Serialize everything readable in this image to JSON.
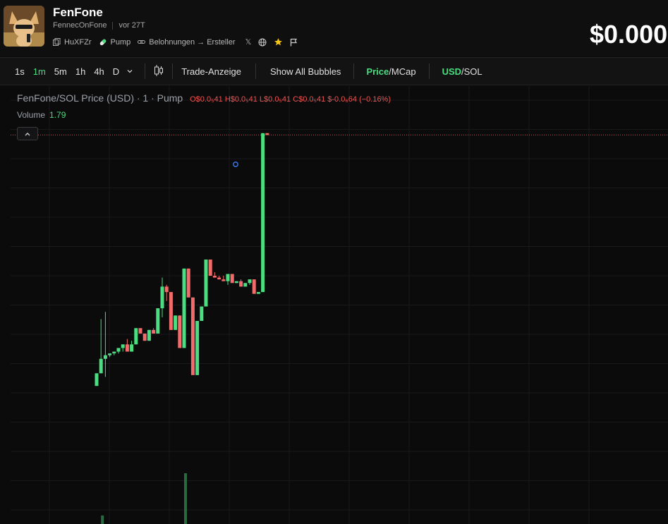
{
  "header": {
    "title": "FenFone",
    "subtitle": "FennecOnFone",
    "age": "vor 27T",
    "meta": {
      "address": "HuXFZr",
      "platform": "Pump",
      "rewards": "Belohnungen → Ersteller",
      "x_icon": "x-social-icon",
      "globe_icon": "globe-icon",
      "star_icon": "star-icon",
      "flag_icon": "flag-icon"
    },
    "price": "$0.000"
  },
  "toolbar": {
    "timeframes": [
      "1s",
      "1m",
      "5m",
      "1h",
      "4h",
      "D"
    ],
    "active_timeframe": "1m",
    "candle_icon": "candlestick-icon",
    "trade_display": "Trade-Anzeige",
    "show_all_bubbles": "Show All Bubbles",
    "price_label": "Price",
    "mcap_label": "MCap",
    "usd_label": "USD",
    "sol_label": "SOL"
  },
  "legend": {
    "title": "FenFone/SOL Price (USD) · 1 · Pump",
    "o": "O$0.0₅41",
    "h": "H$0.0₅41",
    "l": "L$0.0₅41",
    "c": "C$0.0₅41",
    "change": "$-0.0₆64 (−0.16%)",
    "volume_label": "Volume",
    "volume_value": "1.79"
  },
  "colors": {
    "up": "#4ade80",
    "down": "#f26b6b",
    "accent": "#4ade80",
    "background": "#0b0b0c",
    "grid": "#1a1a1c"
  },
  "chart_data": {
    "type": "candlestick",
    "candles": [
      {
        "o": 1.55,
        "h": 1.62,
        "l": 1.55,
        "c": 1.62
      },
      {
        "o": 1.62,
        "h": 1.92,
        "l": 1.62,
        "c": 1.7
      },
      {
        "o": 1.7,
        "h": 1.96,
        "l": 1.6,
        "c": 1.72
      },
      {
        "o": 1.72,
        "h": 1.73,
        "l": 1.71,
        "c": 1.73
      },
      {
        "o": 1.73,
        "h": 1.74,
        "l": 1.72,
        "c": 1.74
      },
      {
        "o": 1.74,
        "h": 1.76,
        "l": 1.73,
        "c": 1.76
      },
      {
        "o": 1.76,
        "h": 1.78,
        "l": 1.74,
        "c": 1.78
      },
      {
        "o": 1.78,
        "h": 1.81,
        "l": 1.75,
        "c": 1.74
      },
      {
        "o": 1.74,
        "h": 1.8,
        "l": 1.74,
        "c": 1.78
      },
      {
        "o": 1.78,
        "h": 1.87,
        "l": 1.78,
        "c": 1.87
      },
      {
        "o": 1.87,
        "h": 1.87,
        "l": 1.84,
        "c": 1.84
      },
      {
        "o": 1.84,
        "h": 1.84,
        "l": 1.8,
        "c": 1.8
      },
      {
        "o": 1.8,
        "h": 1.86,
        "l": 1.8,
        "c": 1.86
      },
      {
        "o": 1.86,
        "h": 1.87,
        "l": 1.84,
        "c": 1.84
      },
      {
        "o": 1.84,
        "h": 1.98,
        "l": 1.84,
        "c": 1.98
      },
      {
        "o": 1.98,
        "h": 2.15,
        "l": 1.93,
        "c": 2.1
      },
      {
        "o": 2.1,
        "h": 2.11,
        "l": 2.02,
        "c": 2.07
      },
      {
        "o": 2.07,
        "h": 2.07,
        "l": 1.86,
        "c": 1.86
      },
      {
        "o": 1.86,
        "h": 1.94,
        "l": 1.86,
        "c": 1.94
      },
      {
        "o": 1.94,
        "h": 1.94,
        "l": 1.76,
        "c": 1.76
      },
      {
        "o": 1.76,
        "h": 2.2,
        "l": 1.76,
        "c": 2.2
      },
      {
        "o": 2.2,
        "h": 2.2,
        "l": 2.04,
        "c": 2.04
      },
      {
        "o": 2.04,
        "h": 2.04,
        "l": 1.61,
        "c": 1.61
      },
      {
        "o": 1.61,
        "h": 1.91,
        "l": 1.61,
        "c": 1.91
      },
      {
        "o": 1.91,
        "h": 1.99,
        "l": 1.91,
        "c": 1.99
      },
      {
        "o": 1.99,
        "h": 2.25,
        "l": 1.99,
        "c": 2.25
      },
      {
        "o": 2.25,
        "h": 2.25,
        "l": 2.16,
        "c": 2.16
      },
      {
        "o": 2.16,
        "h": 2.18,
        "l": 2.15,
        "c": 2.15
      },
      {
        "o": 2.15,
        "h": 2.16,
        "l": 2.14,
        "c": 2.14
      },
      {
        "o": 2.14,
        "h": 2.16,
        "l": 2.13,
        "c": 2.13
      },
      {
        "o": 2.13,
        "h": 2.17,
        "l": 2.11,
        "c": 2.17
      },
      {
        "o": 2.17,
        "h": 2.17,
        "l": 2.12,
        "c": 2.12
      },
      {
        "o": 2.12,
        "h": 2.13,
        "l": 2.12,
        "c": 2.13
      },
      {
        "o": 2.13,
        "h": 2.14,
        "l": 2.1,
        "c": 2.1
      },
      {
        "o": 2.1,
        "h": 2.12,
        "l": 2.1,
        "c": 2.12
      },
      {
        "o": 2.12,
        "h": 2.14,
        "l": 2.11,
        "c": 2.14
      },
      {
        "o": 2.14,
        "h": 2.14,
        "l": 2.06,
        "c": 2.06
      },
      {
        "o": 2.06,
        "h": 2.07,
        "l": 2.06,
        "c": 2.07
      },
      {
        "o": 2.07,
        "h": 2.95,
        "l": 2.07,
        "c": 2.95
      },
      {
        "o": 2.95,
        "h": 2.95,
        "l": 2.94,
        "c": 2.94
      }
    ],
    "volume": [
      {
        "index": 1,
        "value": 0.3
      },
      {
        "index": 20,
        "value": 1.79
      }
    ],
    "ylim": [
      1.0,
      3.0
    ],
    "last_price_line": 2.94,
    "grid": true
  }
}
